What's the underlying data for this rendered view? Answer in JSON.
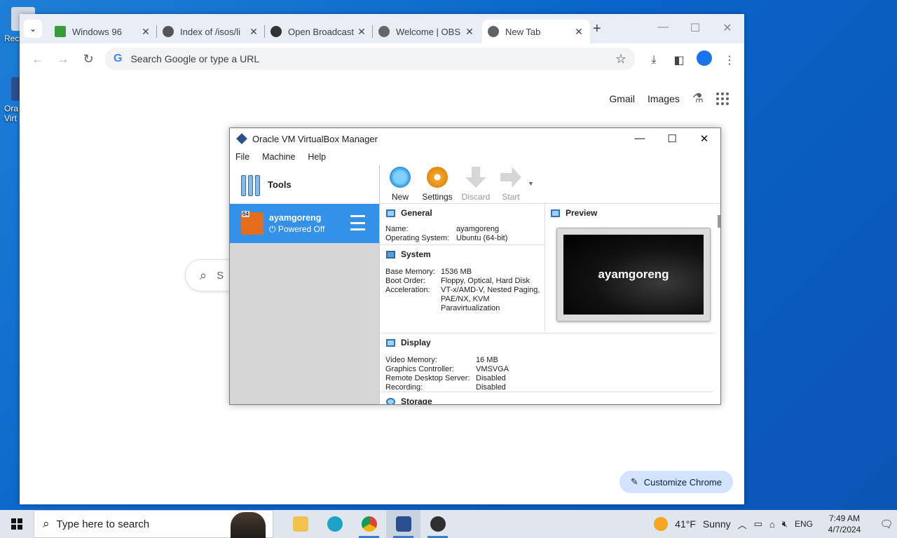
{
  "desktop": {
    "icons": [
      {
        "label": "Rec",
        "icon": "recycle-bin-icon"
      },
      {
        "label": "Ora\nVirt",
        "icon": "virtualbox-icon"
      }
    ]
  },
  "chrome": {
    "tabs": [
      {
        "title": "Windows 96",
        "icon": "windows96-favicon"
      },
      {
        "title": "Index of /isos/li",
        "icon": "archive-favicon"
      },
      {
        "title": "Open Broadcast",
        "icon": "obs-favicon"
      },
      {
        "title": "Welcome | OBS",
        "icon": "globe-favicon"
      },
      {
        "title": "New Tab",
        "icon": "chrome-favicon",
        "active": true
      }
    ],
    "close_glyph": "✕",
    "omnibox_placeholder": "Search Google or type a URL",
    "ntp": {
      "gmail": "Gmail",
      "images": "Images",
      "search_prefix": "S",
      "customize": "Customize Chrome"
    }
  },
  "vbox": {
    "title": "Oracle VM VirtualBox Manager",
    "menu": [
      "File",
      "Machine",
      "Help"
    ],
    "tools_label": "Tools",
    "vm": {
      "name": "ayamgoreng",
      "state": "Powered Off"
    },
    "toolbar": [
      {
        "label": "New",
        "icon": "new-vm-icon",
        "enabled": true
      },
      {
        "label": "Settings",
        "icon": "settings-gear-icon",
        "enabled": true
      },
      {
        "label": "Discard",
        "icon": "discard-arrow-icon",
        "enabled": false
      },
      {
        "label": "Start",
        "icon": "start-arrow-icon",
        "enabled": false
      }
    ],
    "general": {
      "title": "General",
      "rows": [
        {
          "k": "Name:",
          "v": "ayamgoreng"
        },
        {
          "k": "Operating System:",
          "v": "Ubuntu (64-bit)"
        }
      ]
    },
    "system": {
      "title": "System",
      "rows": [
        {
          "k": "Base Memory:",
          "v": "1536 MB"
        },
        {
          "k": "Boot Order:",
          "v": "Floppy, Optical, Hard Disk"
        },
        {
          "k": "Acceleration:",
          "v": "VT-x/AMD-V, Nested Paging, PAE/NX, KVM Paravirtualization"
        }
      ]
    },
    "preview": {
      "title": "Preview",
      "screen_text": "ayamgoreng"
    },
    "display": {
      "title": "Display",
      "rows": [
        {
          "k": "Video Memory:",
          "v": "16 MB"
        },
        {
          "k": "Graphics Controller:",
          "v": "VMSVGA"
        },
        {
          "k": "Remote Desktop Server:",
          "v": "Disabled"
        },
        {
          "k": "Recording:",
          "v": "Disabled"
        }
      ]
    },
    "storage": {
      "title": "Storage"
    }
  },
  "taskbar": {
    "search_placeholder": "Type here to search",
    "weather": {
      "temp": "41°F",
      "desc": "Sunny"
    },
    "lang": "ENG",
    "time": "7:49 AM",
    "date": "4/7/2024"
  }
}
